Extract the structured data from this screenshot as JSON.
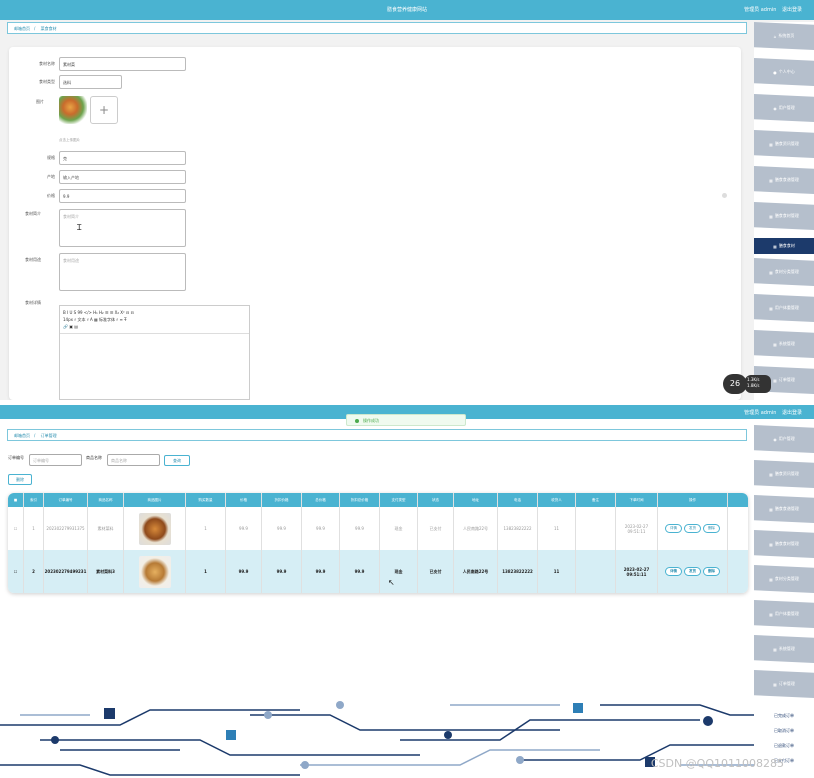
{
  "app": {
    "title": "膳食营养健康网站",
    "user_label": "管理员 admin",
    "logout": "退出登录"
  },
  "top": {
    "breadcrumb": [
      "邮箱首页",
      "菜食食材"
    ],
    "sidebar": [
      {
        "icon": "home-icon",
        "label": "系统首页"
      },
      {
        "icon": "user-icon",
        "label": "个人中心"
      },
      {
        "icon": "users-icon",
        "label": "用户管理"
      },
      {
        "icon": "grid-icon",
        "label": "膳食资讯管理"
      },
      {
        "icon": "grid-icon",
        "label": "膳食食谱管理"
      },
      {
        "icon": "grid-icon",
        "label": "膳食食材管理"
      },
      {
        "icon": "grid-icon",
        "label": "膳食食材",
        "active": true
      },
      {
        "icon": "grid-icon",
        "label": "食材分类管理"
      },
      {
        "icon": "grid-icon",
        "label": "用户体重管理"
      },
      {
        "icon": "grid-icon",
        "label": "系统管理"
      },
      {
        "icon": "grid-icon",
        "label": "订单管理"
      }
    ],
    "form": {
      "name_label": "食材名称",
      "name_value": "素材菜",
      "category_label": "食材类型",
      "category_value": "选料",
      "image_label": "图片",
      "image_hint": "点击上传图片",
      "spec_label": "规格",
      "spec_value": "克",
      "origin_label": "产地",
      "origin_placeholder": "输入产地",
      "price_label": "价格",
      "price_value": "9.9",
      "intro_label": "食材简介",
      "intro_placeholder": "食材简介",
      "usage_label": "食材用途",
      "usage_placeholder": "食材用途",
      "detail_label": "食材详情",
      "editor_toolbar": [
        "B  I  U  S    99  </>    H₁  H₂    ☰  ☰    X₂  X²    ⊟  ⊟",
        "14px    ♯    文本    ♯    A   ▦    标准字体    ♯    ≡    T̶",
        "🔗  ▣  ▤"
      ]
    },
    "speed_badge": "26",
    "mini_stats": [
      "1.3K/s",
      "1.8K/s"
    ]
  },
  "bottom": {
    "toast": "操作成功",
    "breadcrumb": [
      "邮箱首页",
      "订单管理"
    ],
    "search": {
      "order_label": "订单编号",
      "order_placeholder": "订单编号",
      "product_label": "商品名称",
      "product_placeholder": "商品名称",
      "search_button": "查询",
      "delete_button": "删除"
    },
    "table": {
      "headers": [
        "",
        "索引",
        "订单编号",
        "商品名称",
        "商品图片",
        "购买数量",
        "价格",
        "折扣价格",
        "总价格",
        "折扣总价格",
        "支付类型",
        "状态",
        "地址",
        "电话",
        "收货人",
        "备注",
        "下单时间",
        "操作"
      ],
      "rows": [
        [
          "",
          "1",
          "202302279931375",
          "素材菜料",
          "",
          "1",
          "99.9",
          "99.9",
          "99.9",
          "99.9",
          "现金",
          "已支付",
          "人民南路22号",
          "13823822222",
          "11",
          "",
          "2023-02-27 09:51:11"
        ],
        [
          "",
          "2",
          "202302279499231",
          "素材菜料3",
          "",
          "1",
          "99.9",
          "99.9",
          "99.9",
          "99.9",
          "现金",
          "已支付",
          "人民南路22号",
          "13823822222",
          "11",
          "",
          "2023-02-27 09:51:11"
        ]
      ],
      "actions": [
        "详情",
        "发货",
        "删除"
      ]
    },
    "sidebar": [
      {
        "icon": "users-icon",
        "label": "用户管理"
      },
      {
        "icon": "grid-icon",
        "label": "膳食资讯管理"
      },
      {
        "icon": "grid-icon",
        "label": "膳食食谱管理"
      },
      {
        "icon": "grid-icon",
        "label": "膳食食材管理"
      },
      {
        "icon": "grid-icon",
        "label": "食材分类管理"
      },
      {
        "icon": "grid-icon",
        "label": "用户体重管理"
      },
      {
        "icon": "grid-icon",
        "label": "系统管理"
      },
      {
        "icon": "grid-icon",
        "label": "订单管理"
      }
    ],
    "submenu": [
      "已完成订单",
      "已取消订单",
      "已退款订单",
      "已支付订单"
    ],
    "watermark": "CSDN @QQ1011008285"
  },
  "colors": {
    "header": "#4ab3d1",
    "sidebar": "#b5bfcc",
    "active": "#1c3a6b"
  }
}
